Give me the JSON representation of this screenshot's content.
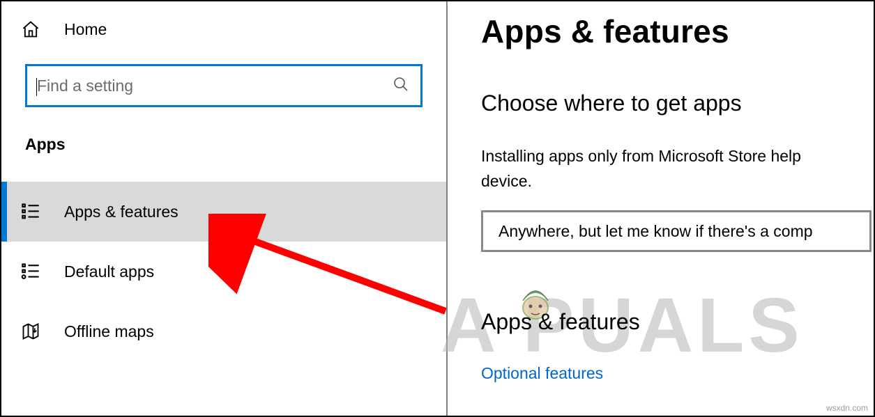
{
  "sidebar": {
    "home_label": "Home",
    "search_placeholder": "Find a setting",
    "section_title": "Apps",
    "items": [
      {
        "label": "Apps & features",
        "selected": true
      },
      {
        "label": "Default apps",
        "selected": false
      },
      {
        "label": "Offline maps",
        "selected": false
      }
    ]
  },
  "main": {
    "title": "Apps & features",
    "section1_heading": "Choose where to get apps",
    "section1_desc_line1": "Installing apps only from Microsoft Store help",
    "section1_desc_line2": "device.",
    "dropdown_value": "Anywhere, but let me know if there's a comp",
    "section2_heading": "Apps & features",
    "optional_link": "Optional features"
  },
  "watermark": {
    "text": "A  PUALS",
    "source": "wsxdn.com"
  }
}
